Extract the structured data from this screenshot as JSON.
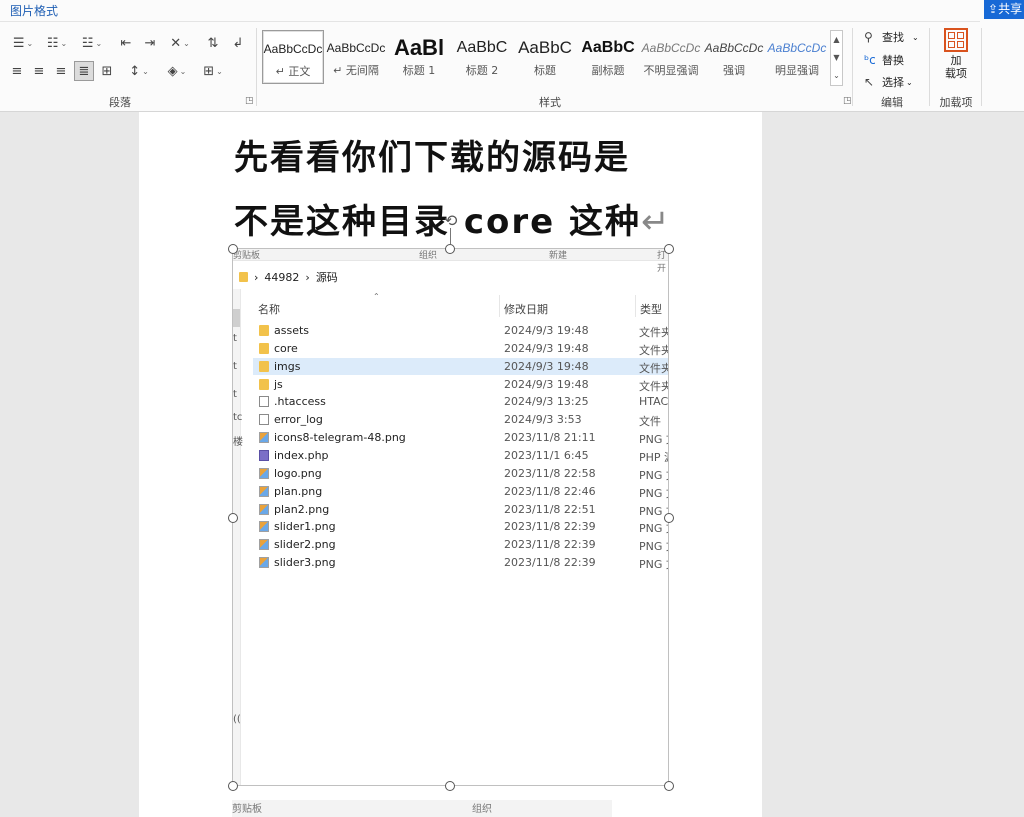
{
  "ribbon": {
    "context_tab": "图片格式",
    "share_label": "共享",
    "groups": {
      "paragraph": "段落",
      "styles": "样式",
      "editing": "编辑",
      "addins": "加载项"
    },
    "styles": [
      {
        "sample": "AaBbCcDc",
        "name": "↵ 正文",
        "selected": true
      },
      {
        "sample": "AaBbCcDc",
        "name": "↵ 无间隔",
        "selected": false
      },
      {
        "sample": "AaBl",
        "name": "标题 1",
        "selected": false
      },
      {
        "sample": "AaBbC",
        "name": "标题 2",
        "selected": false
      },
      {
        "sample": "AaBbC",
        "name": "标题",
        "selected": false
      },
      {
        "sample": "AaBbC",
        "name": "副标题",
        "selected": false
      },
      {
        "sample": "AaBbCcDc",
        "name": "不明显强调",
        "selected": false
      },
      {
        "sample": "AaBbCcDc",
        "name": "强调",
        "selected": false
      },
      {
        "sample": "AaBbCcDc",
        "name": "明显强调",
        "selected": false
      }
    ],
    "editing": {
      "find": "查找",
      "replace": "替换",
      "select": "选择"
    },
    "addins": {
      "button": "加\n载项"
    }
  },
  "document": {
    "line1": "先看看你们下载的源码是",
    "line2": "不是这种目录  core 这种",
    "para_mark": "↵"
  },
  "picture": {
    "ribbon_strip": [
      "剪贴板",
      "组织",
      "新建",
      "打开"
    ],
    "breadcrumb": [
      "44982",
      "源码"
    ],
    "columns": {
      "name": "名称",
      "date": "修改日期",
      "type": "类型"
    },
    "side_chars": [
      "t",
      "t",
      "t",
      "tc",
      "楼",
      "(("
    ],
    "files": [
      {
        "name": "assets",
        "date": "2024/9/3 19:48",
        "type": "文件夹",
        "kind": "folder"
      },
      {
        "name": "core",
        "date": "2024/9/3 19:48",
        "type": "文件夹",
        "kind": "folder"
      },
      {
        "name": "imgs",
        "date": "2024/9/3 19:48",
        "type": "文件夹",
        "kind": "folder",
        "selected": true
      },
      {
        "name": "js",
        "date": "2024/9/3 19:48",
        "type": "文件夹",
        "kind": "folder"
      },
      {
        "name": ".htaccess",
        "date": "2024/9/3 13:25",
        "type": "HTACC",
        "kind": "file"
      },
      {
        "name": "error_log",
        "date": "2024/9/3 3:53",
        "type": "文件",
        "kind": "file"
      },
      {
        "name": "icons8-telegram-48.png",
        "date": "2023/11/8 21:11",
        "type": "PNG 文",
        "kind": "png"
      },
      {
        "name": "index.php",
        "date": "2023/11/1 6:45",
        "type": "PHP 源",
        "kind": "php"
      },
      {
        "name": "logo.png",
        "date": "2023/11/8 22:58",
        "type": "PNG 文",
        "kind": "png"
      },
      {
        "name": "plan.png",
        "date": "2023/11/8 22:46",
        "type": "PNG 文",
        "kind": "png"
      },
      {
        "name": "plan2.png",
        "date": "2023/11/8 22:51",
        "type": "PNG 文",
        "kind": "png"
      },
      {
        "name": "slider1.png",
        "date": "2023/11/8 22:39",
        "type": "PNG 文",
        "kind": "png"
      },
      {
        "name": "slider2.png",
        "date": "2023/11/8 22:39",
        "type": "PNG 文",
        "kind": "png"
      },
      {
        "name": "slider3.png",
        "date": "2023/11/8 22:39",
        "type": "PNG 文",
        "kind": "png"
      }
    ],
    "below_strip": [
      "剪贴板",
      "组织"
    ]
  },
  "colors": {
    "accent": "#1769d6",
    "folder": "#f2c24b",
    "selection": "#dcebfa"
  }
}
